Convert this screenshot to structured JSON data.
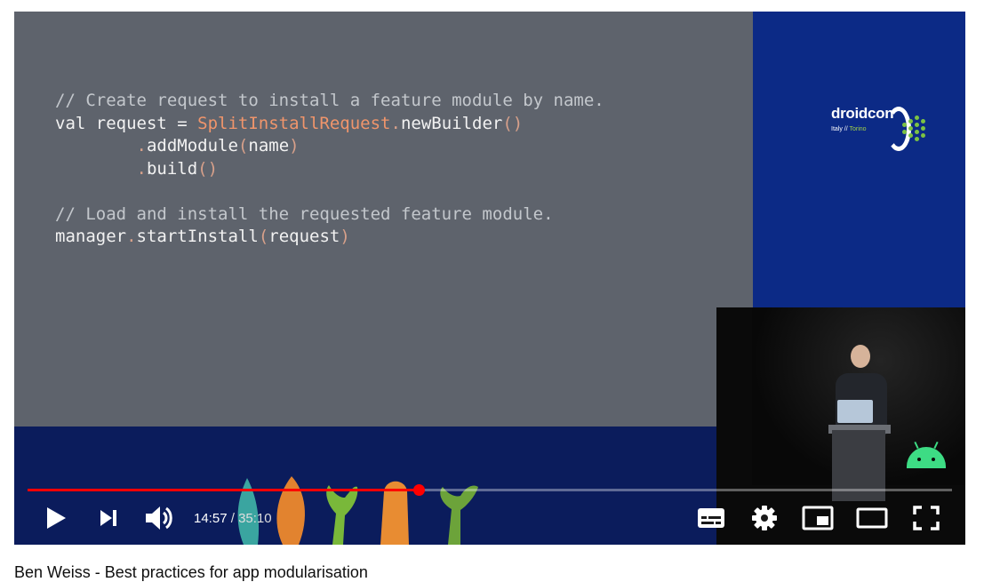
{
  "slide": {
    "code": [
      {
        "parts": [
          {
            "t": "// Create request to install a feature module by name.",
            "c": "cm"
          }
        ]
      },
      {
        "parts": [
          {
            "t": "val request = ",
            "c": ""
          },
          {
            "t": "SplitInstallRequest",
            "c": "or"
          },
          {
            "t": ".",
            "c": "dim"
          },
          {
            "t": "newBuilder",
            "c": ""
          },
          {
            "t": "()",
            "c": "dim"
          }
        ]
      },
      {
        "parts": [
          {
            "t": "        ",
            "c": ""
          },
          {
            "t": ".",
            "c": "dim"
          },
          {
            "t": "addModule",
            "c": ""
          },
          {
            "t": "(",
            "c": "dim"
          },
          {
            "t": "name",
            "c": ""
          },
          {
            "t": ")",
            "c": "dim"
          }
        ]
      },
      {
        "parts": [
          {
            "t": "        ",
            "c": ""
          },
          {
            "t": ".",
            "c": "dim"
          },
          {
            "t": "build",
            "c": ""
          },
          {
            "t": "()",
            "c": "dim"
          }
        ]
      },
      {
        "parts": [
          {
            "t": "",
            "c": ""
          }
        ]
      },
      {
        "parts": [
          {
            "t": "// Load and install the requested feature module.",
            "c": "cm"
          }
        ]
      },
      {
        "parts": [
          {
            "t": "manager",
            "c": ""
          },
          {
            "t": ".",
            "c": "dim"
          },
          {
            "t": "startInstall",
            "c": ""
          },
          {
            "t": "(",
            "c": "dim"
          },
          {
            "t": "request",
            "c": ""
          },
          {
            "t": ")",
            "c": "dim"
          }
        ]
      }
    ]
  },
  "branding": {
    "logo_text": "droidcon",
    "logo_sub_main": "Italy // ",
    "logo_sub_city": "Torino"
  },
  "player": {
    "progress_fraction": 0.423,
    "current_time": "14:57",
    "separator": " / ",
    "duration": "35:10",
    "icons": {
      "play": "play-icon",
      "next": "next-icon",
      "volume": "volume-icon",
      "subtitles": "subtitles-icon",
      "settings": "settings-icon",
      "miniplayer": "miniplayer-icon",
      "theater": "theater-mode-icon",
      "fullscreen": "fullscreen-icon"
    },
    "colors": {
      "progress": "#ff0000",
      "slide_bg": "#5e636c",
      "brand_bg": "#0c2a86",
      "accent_orange": "#f0956b"
    }
  },
  "caption": {
    "text": "Ben Weiss - Best practices for app modularisation"
  }
}
